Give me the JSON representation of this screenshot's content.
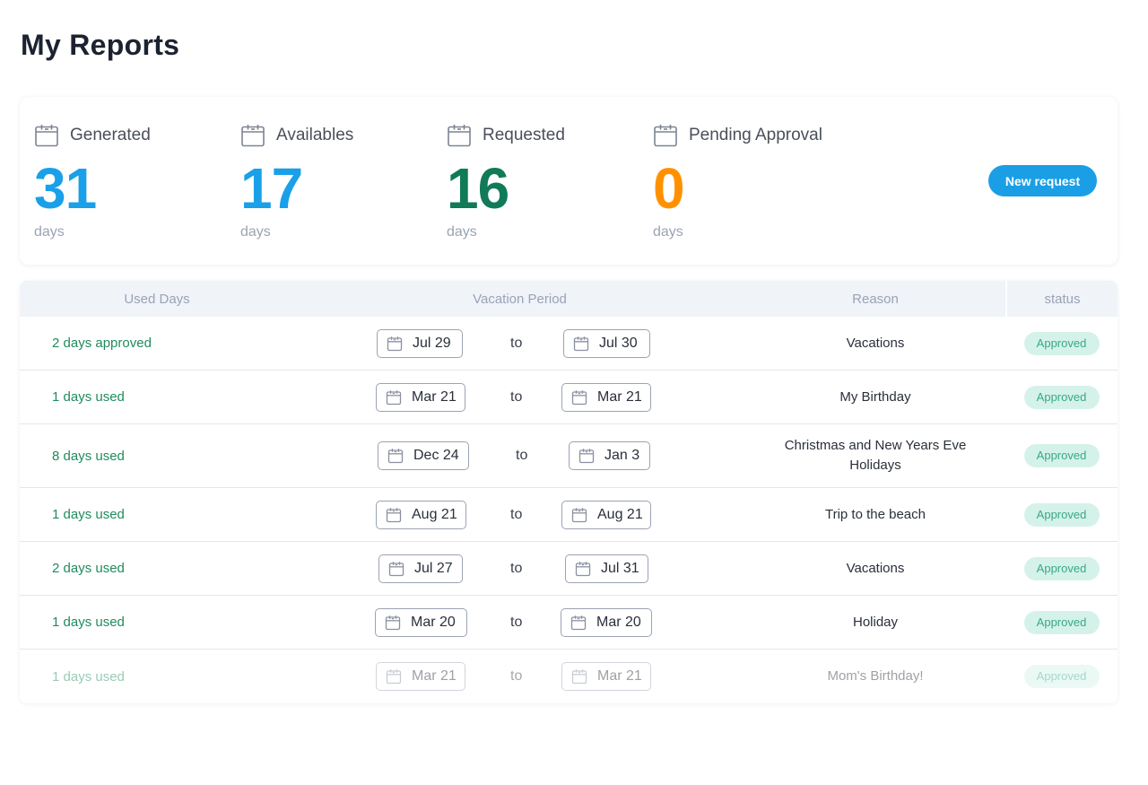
{
  "page_title": "My Reports",
  "summary": {
    "stats": [
      {
        "label": "Generated",
        "value": "31",
        "unit": "days",
        "color": "#1aa0e8"
      },
      {
        "label": "Availables",
        "value": "17",
        "unit": "days",
        "color": "#1aa0e8"
      },
      {
        "label": "Requested",
        "value": "16",
        "unit": "days",
        "color": "#117a58"
      },
      {
        "label": "Pending Approval",
        "value": "0",
        "unit": "days",
        "color": "#ff9100"
      }
    ],
    "new_request_label": "New request",
    "stat_icon": "calendar-icon"
  },
  "table": {
    "headers": {
      "used": "Used Days",
      "period": "Vacation Period",
      "reason": "Reason",
      "status": "status"
    },
    "to_label": "to",
    "rows": [
      {
        "used": "2 days approved",
        "from": "Jul 29",
        "to": "Jul 30",
        "reason": "Vacations",
        "status": "Approved"
      },
      {
        "used": "1 days used",
        "from": "Mar 21",
        "to": "Mar 21",
        "reason": "My Birthday",
        "status": "Approved"
      },
      {
        "used": "8 days used",
        "from": "Dec 24",
        "to": "Jan 3",
        "reason": "Christmas and New Years Eve Holidays",
        "status": "Approved"
      },
      {
        "used": "1 days used",
        "from": "Aug 21",
        "to": "Aug 21",
        "reason": "Trip to the beach",
        "status": "Approved"
      },
      {
        "used": "2 days used",
        "from": "Jul 27",
        "to": "Jul 31",
        "reason": "Vacations",
        "status": "Approved"
      },
      {
        "used": "1 days used",
        "from": "Mar 20",
        "to": "Mar 20",
        "reason": "Holiday",
        "status": "Approved"
      },
      {
        "used": "1 days used",
        "from": "Mar 21",
        "to": "Mar 21",
        "reason": "Mom's Birthday!",
        "status": "Approved"
      }
    ]
  },
  "colors": {
    "accent": "#1a9fe6",
    "used_text": "#1f8c5c",
    "badge_bg": "#d5f2ea",
    "badge_text": "#38a886"
  }
}
